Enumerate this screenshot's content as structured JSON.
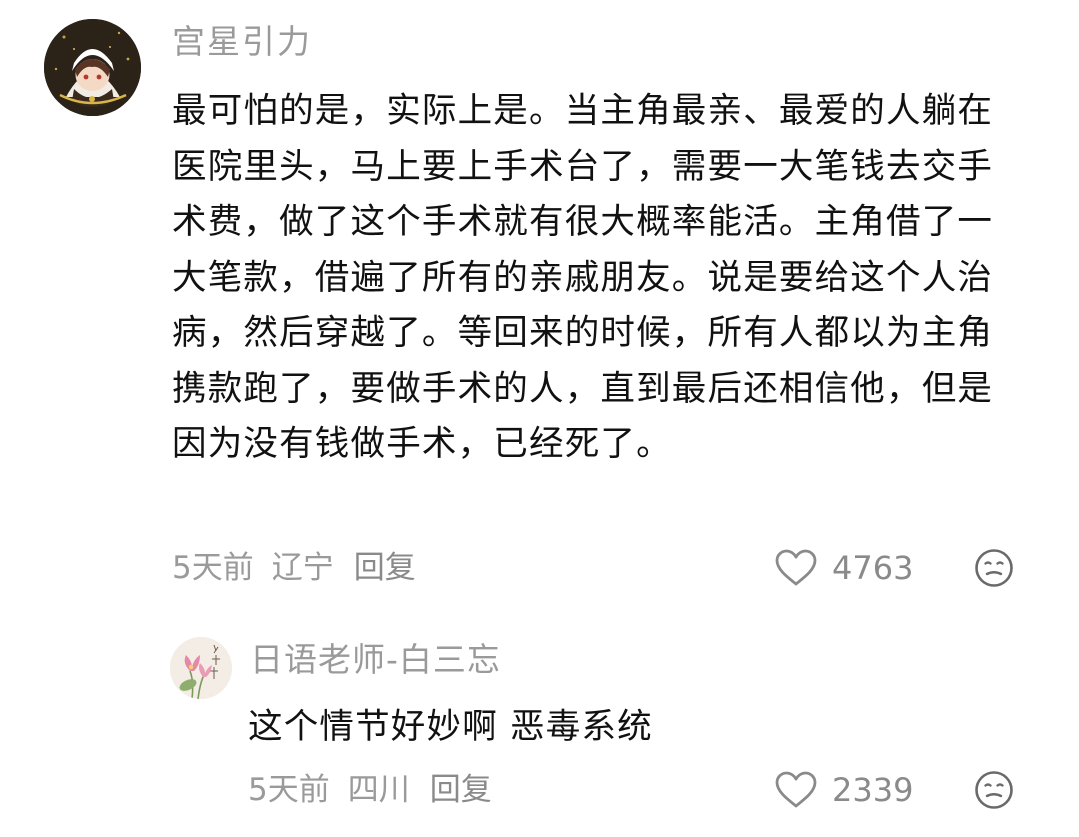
{
  "comments": [
    {
      "username": "宫星引力",
      "content": "最可怕的是，实际上是。当主角最亲、最爱的人躺在医院里头，马上要上手术台了，需要一大笔钱去交手术费，做了这个手术就有很大概率能活。主角借了一大笔款，借遍了所有的亲戚朋友。说是要给这个人治病，然后穿越了。等回来的时候，所有人都以为主角携款跑了，要做手术的人，直到最后还相信他，但是因为没有钱做手术，已经死了。",
      "time": "5天前",
      "location": "辽宁",
      "reply_label": "回复",
      "likes": "4763",
      "avatar_icon": "anime-avatar",
      "reply": {
        "username": "日语老师-白三忘",
        "content": "这个情节好妙啊 恶毒系统",
        "time": "5天前",
        "location": "四川",
        "reply_label": "回复",
        "likes": "2339",
        "avatar_icon": "lotus-avatar"
      }
    }
  ],
  "icons": {
    "like": "heart-outline-icon",
    "emoji": "meh-face-icon"
  },
  "colors": {
    "text": "#111111",
    "muted": "#9a9a9a",
    "background": "#ffffff"
  }
}
